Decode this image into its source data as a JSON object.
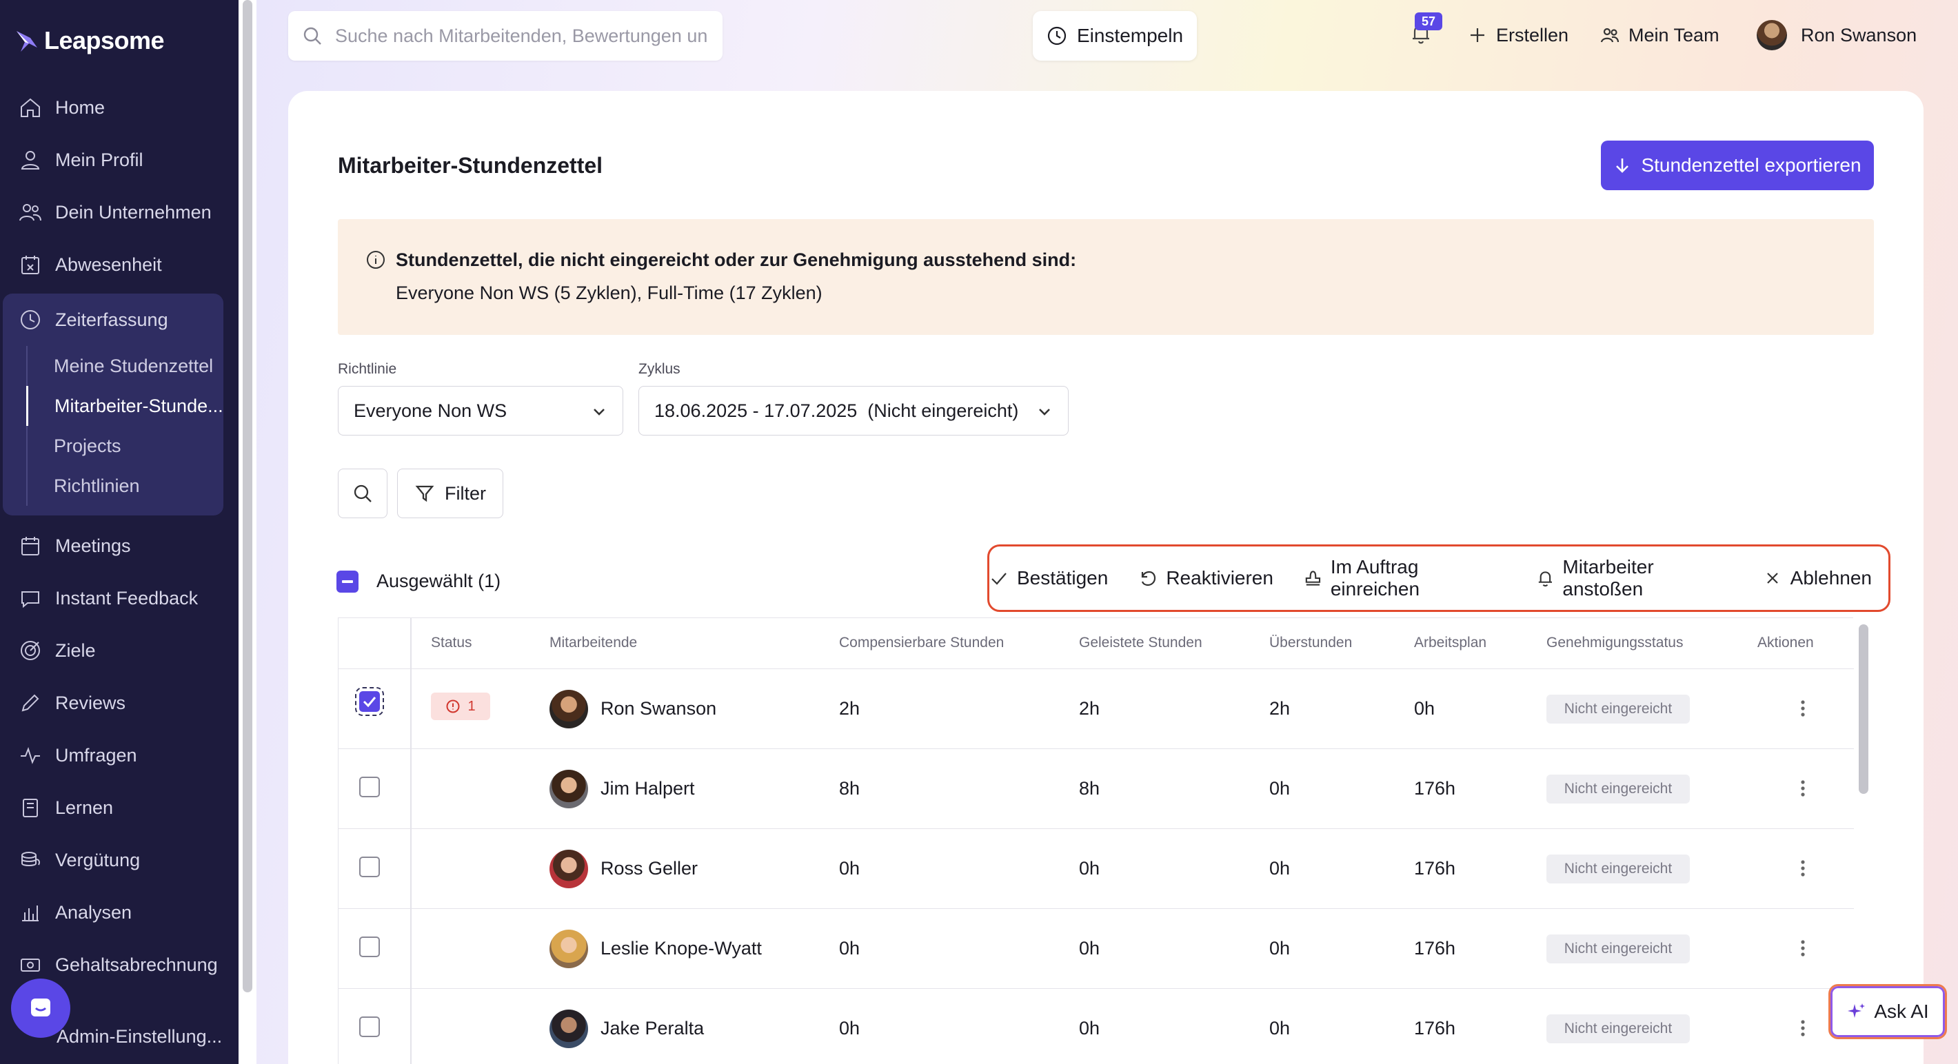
{
  "app": {
    "logo_text": "Leapsome"
  },
  "sidebar": {
    "items": [
      {
        "label": "Home",
        "icon": "home-icon"
      },
      {
        "label": "Mein Profil",
        "icon": "user-icon"
      },
      {
        "label": "Dein Unternehmen",
        "icon": "users-icon"
      },
      {
        "label": "Abwesenheit",
        "icon": "calendar-x-icon"
      },
      {
        "label": "Zeiterfassung",
        "icon": "clock-icon"
      },
      {
        "label": "Meetings",
        "icon": "calendar-icon"
      },
      {
        "label": "Instant Feedback",
        "icon": "chat-icon"
      },
      {
        "label": "Ziele",
        "icon": "target-icon"
      },
      {
        "label": "Reviews",
        "icon": "pencil-icon"
      },
      {
        "label": "Umfragen",
        "icon": "pulse-icon"
      },
      {
        "label": "Lernen",
        "icon": "book-icon"
      },
      {
        "label": "Vergütung",
        "icon": "coins-icon"
      },
      {
        "label": "Analysen",
        "icon": "chart-icon"
      },
      {
        "label": "Gehaltsabrechnung",
        "icon": "money-icon"
      },
      {
        "label": "Admin-Einstellung...",
        "icon": "gear-icon"
      }
    ],
    "subitems": [
      {
        "label": "Meine Studenzettel",
        "active": false
      },
      {
        "label": "Mitarbeiter-Stunde...",
        "active": true
      },
      {
        "label": "Projects",
        "active": false
      },
      {
        "label": "Richtlinien",
        "active": false
      }
    ]
  },
  "topbar": {
    "search_placeholder": "Suche nach Mitarbeitenden, Bewertungen un",
    "clockin_label": "Einstempeln",
    "notification_count": "57",
    "create_label": "Erstellen",
    "team_label": "Mein Team",
    "user_name": "Ron Swanson"
  },
  "page": {
    "title": "Mitarbeiter-Stundenzettel",
    "export_label": "Stundenzettel exportieren",
    "notice_title": "Stundenzettel, die nicht eingereicht oder zur Genehmigung ausstehend sind:",
    "notice_text": "Everyone Non WS (5 Zyklen), Full-Time (17 Zyklen)",
    "policy_label": "Richtlinie",
    "policy_value": "Everyone Non WS",
    "cycle_label": "Zyklus",
    "cycle_value": "18.06.2025 - 17.07.2025  (Nicht eingereicht)",
    "filter_label": "Filter",
    "selected_label": "Ausgewählt (1)"
  },
  "bulk_actions": {
    "confirm": "Bestätigen",
    "reactivate": "Reaktivieren",
    "submit_on_behalf": "Im Auftrag einreichen",
    "nudge": "Mitarbeiter anstoßen",
    "reject": "Ablehnen"
  },
  "table": {
    "headers": {
      "status": "Status",
      "employee": "Mitarbeitende",
      "compensable": "Compensierbare Stunden",
      "worked": "Geleistete Stunden",
      "overtime": "Überstunden",
      "schedule": "Arbeitsplan",
      "approval": "Genehmigungsstatus",
      "actions": "Aktionen"
    },
    "rows": [
      {
        "name": "Ron Swanson",
        "status_count": "1",
        "compensable": "2h",
        "worked": "2h",
        "overtime": "2h",
        "schedule": "0h",
        "approval": "Nicht eingereicht"
      },
      {
        "name": "Jim Halpert",
        "compensable": "8h",
        "worked": "8h",
        "overtime": "0h",
        "schedule": "176h",
        "approval": "Nicht eingereicht"
      },
      {
        "name": "Ross Geller",
        "compensable": "0h",
        "worked": "0h",
        "overtime": "0h",
        "schedule": "176h",
        "approval": "Nicht eingereicht"
      },
      {
        "name": "Leslie Knope-Wyatt",
        "compensable": "0h",
        "worked": "0h",
        "overtime": "0h",
        "schedule": "176h",
        "approval": "Nicht eingereicht"
      },
      {
        "name": "Jake Peralta",
        "compensable": "0h",
        "worked": "0h",
        "overtime": "0h",
        "schedule": "176h",
        "approval": "Nicht eingereicht"
      }
    ]
  },
  "ask_ai_label": "Ask AI",
  "colors": {
    "sidebar_bg": "#1d1b3d",
    "accent": "#5a47e6",
    "highlight_border": "#e24a2e"
  }
}
